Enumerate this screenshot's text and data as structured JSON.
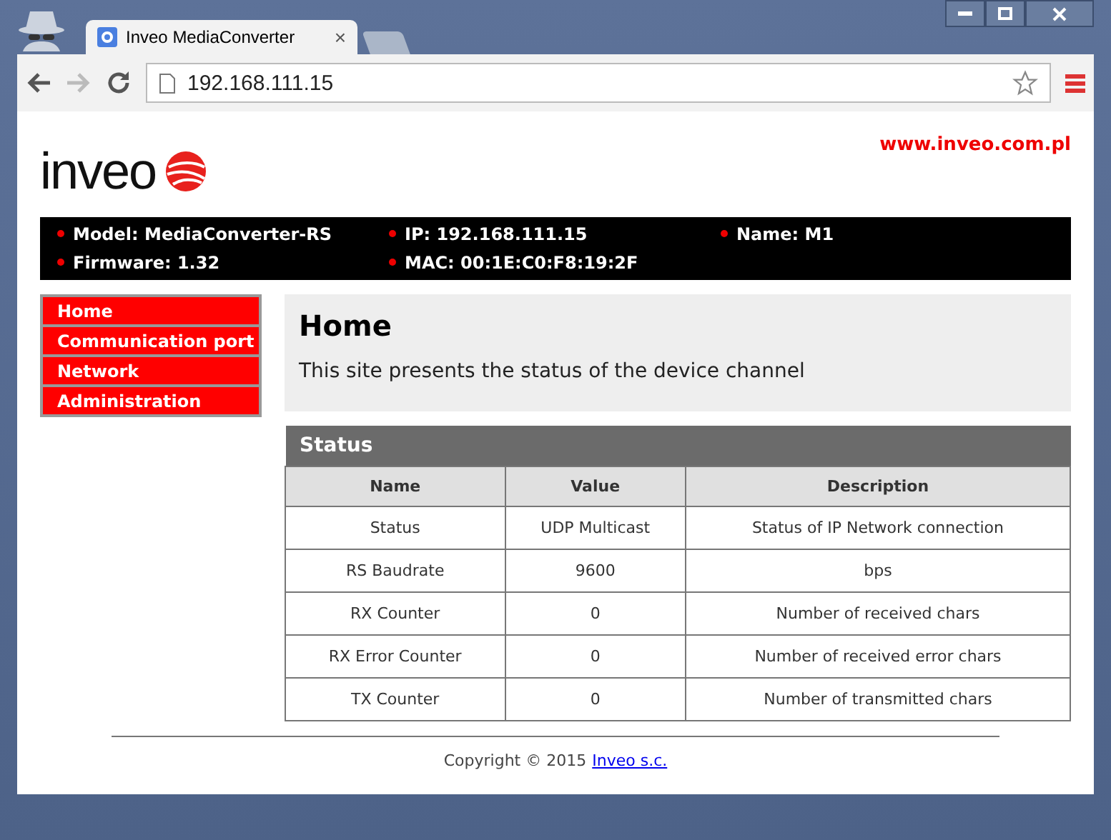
{
  "browser": {
    "tabs": [
      {
        "title": "Inveo MediaConverter",
        "close": "×",
        "selected": true
      }
    ],
    "address": "192.168.111.15"
  },
  "header": {
    "logo": "inveo",
    "link": "www.inveo.com.pl"
  },
  "info_bar": [
    {
      "text": "Model: MediaConverter-RS"
    },
    {
      "text": "IP: 192.168.111.15"
    },
    {
      "text": "Name: M1"
    },
    {
      "text": "Firmware: 1.32"
    },
    {
      "text": "MAC: 00:1E:C0:F8:19:2F"
    }
  ],
  "sidebar": {
    "items": [
      {
        "label": "Home"
      },
      {
        "label": "Communication port"
      },
      {
        "label": "Network"
      },
      {
        "label": "Administration"
      }
    ]
  },
  "intro": {
    "title": "Home",
    "text": "This site presents the status of the device channel"
  },
  "status": {
    "title": "Status",
    "columns": [
      "Name",
      "Value",
      "Description"
    ],
    "rows": [
      [
        "Status",
        "UDP Multicast",
        "Status of IP Network connection"
      ],
      [
        "RS Baudrate",
        "9600",
        "bps"
      ],
      [
        "RX Counter",
        "0",
        "Number of received chars"
      ],
      [
        "RX Error Counter",
        "0",
        "Number of received error chars"
      ],
      [
        "TX Counter",
        "0",
        "Number of transmitted chars"
      ]
    ]
  },
  "footer": {
    "copyright": "Copyright © 2015",
    "link": "Inveo s.c."
  }
}
